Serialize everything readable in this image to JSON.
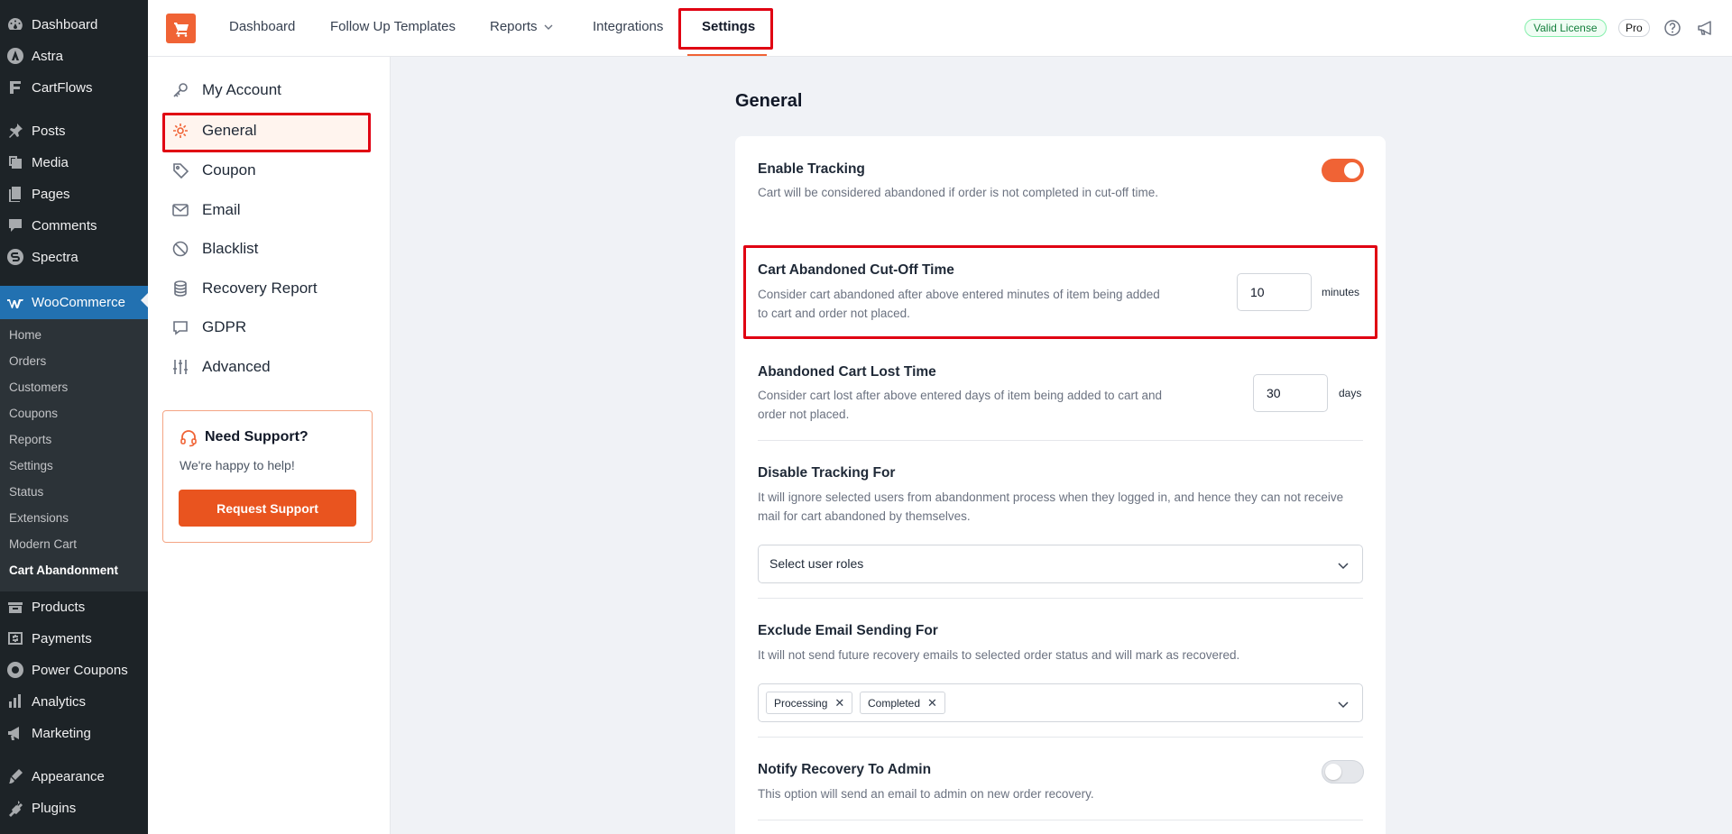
{
  "wp_menu": {
    "items": [
      {
        "label": "Dashboard",
        "icon": "dashboard-icon"
      },
      {
        "label": "Astra",
        "icon": "astra-icon"
      },
      {
        "label": "CartFlows",
        "icon": "cartflows-icon"
      },
      {
        "label": "Posts",
        "icon": "pin-icon"
      },
      {
        "label": "Media",
        "icon": "media-icon"
      },
      {
        "label": "Pages",
        "icon": "pages-icon"
      },
      {
        "label": "Comments",
        "icon": "comments-icon"
      },
      {
        "label": "Spectra",
        "icon": "spectra-icon"
      },
      {
        "label": "WooCommerce",
        "icon": "woocommerce-icon"
      },
      {
        "label": "Products",
        "icon": "products-icon"
      },
      {
        "label": "Payments",
        "icon": "payments-icon"
      },
      {
        "label": "Power Coupons",
        "icon": "power-coupons-icon"
      },
      {
        "label": "Analytics",
        "icon": "analytics-icon"
      },
      {
        "label": "Marketing",
        "icon": "marketing-icon"
      },
      {
        "label": "Appearance",
        "icon": "appearance-icon"
      },
      {
        "label": "Plugins",
        "icon": "plugins-icon"
      }
    ],
    "woo_submenu": [
      "Home",
      "Orders",
      "Customers",
      "Coupons",
      "Reports",
      "Settings",
      "Status",
      "Extensions",
      "Modern Cart",
      "Cart Abandonment"
    ]
  },
  "topbar": {
    "nav": {
      "dashboard": "Dashboard",
      "follow_up": "Follow Up Templates",
      "reports": "Reports",
      "integrations": "Integrations",
      "settings": "Settings"
    },
    "license_badge": "Valid License",
    "pro_badge": "Pro"
  },
  "subnav": {
    "items": [
      "My Account",
      "General",
      "Coupon",
      "Email",
      "Blacklist",
      "Recovery Report",
      "GDPR",
      "Advanced"
    ],
    "support": {
      "title": "Need Support?",
      "subtitle": "We're happy to help!",
      "button": "Request Support"
    }
  },
  "main": {
    "title": "General",
    "enable_tracking": {
      "title": "Enable Tracking",
      "desc": "Cart will be considered abandoned if order is not completed in cut-off time.",
      "on": true
    },
    "cutoff": {
      "title": "Cart Abandoned Cut-Off Time",
      "desc": "Consider cart abandoned after above entered minutes of item being added to cart and order not placed.",
      "value": "10",
      "unit": "minutes"
    },
    "lost_time": {
      "title": "Abandoned Cart Lost Time",
      "desc": "Consider cart lost after above entered days of item being added to cart and order not placed.",
      "value": "30",
      "unit": "days"
    },
    "disable_tracking": {
      "title": "Disable Tracking For",
      "desc": "It will ignore selected users from abandonment process when they logged in, and hence they can not receive mail for cart abandoned by themselves.",
      "placeholder": "Select user roles"
    },
    "exclude_email": {
      "title": "Exclude Email Sending For",
      "desc": "It will not send future recovery emails to selected order status and will mark as recovered.",
      "chips": [
        "Processing",
        "Completed"
      ]
    },
    "notify_admin": {
      "title": "Notify Recovery To Admin",
      "desc": "This option will send an email to admin on new order recovery.",
      "on": false
    }
  },
  "colors": {
    "accent": "#f06335",
    "highlight": "#e00012",
    "wp_sidebar": "#1d2327",
    "wp_active": "#2271b1"
  }
}
